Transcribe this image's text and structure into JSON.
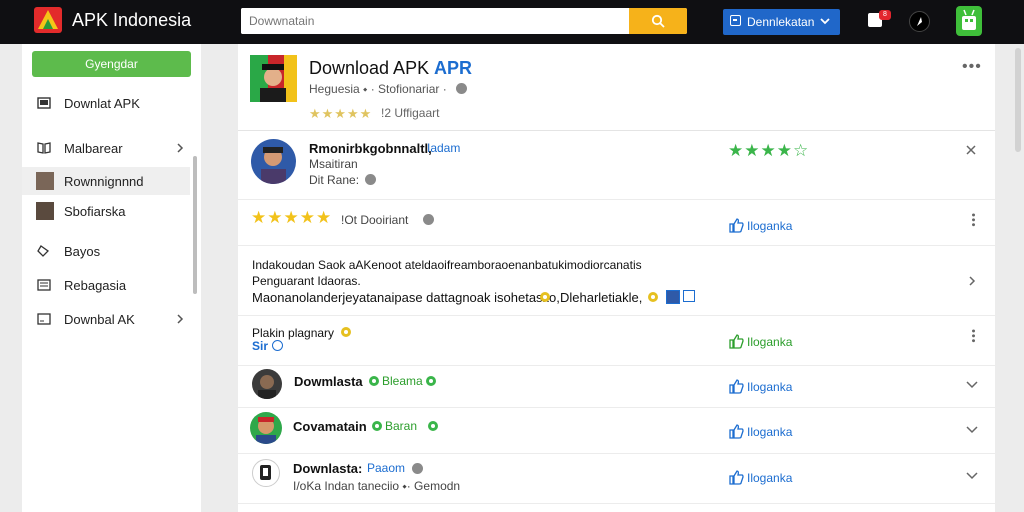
{
  "header": {
    "brand": "APK Indonesia",
    "search_placeholder": "Dowwnatain",
    "download_label": "Dennlekatan",
    "notif_count": "8"
  },
  "sidebar": {
    "primary_button": "Gyengdar",
    "items": [
      {
        "label": "Downlat APK"
      },
      {
        "label": "Malbarear"
      },
      {
        "label": "Rownnignnnd"
      },
      {
        "label": "Sbofiarska"
      },
      {
        "label": "Bayos"
      },
      {
        "label": "Rebagasia"
      },
      {
        "label": "Downbal AK"
      }
    ]
  },
  "app": {
    "title": "Download APK .",
    "title_accent": "APR",
    "subtitle": "Heguesia ⬩ · Stofionariar ·",
    "rating_stars": "★★★★★",
    "rating_text": "!2 Uffigaart"
  },
  "rows": {
    "r1": {
      "name": "Rmonirbkgobnnaltl,",
      "tag": "Iadam",
      "line2": "Msaitiran",
      "line3": "Dit Rane:",
      "stars": "★★★★☆"
    },
    "r2": {
      "stars": "★★★★★",
      "text": "!Ot Dooiriant",
      "action": "Iloganka"
    },
    "r3": {
      "line1": "Indakoudan Saok aAKenoot ateldaoifreamboraoenanbatukimodiorcanatis",
      "line2": "Penguarant Idaoras.",
      "line3": "Maonanolanderjeyatanaipase dattagnoak isohetasko,",
      "line3b": "Dleharletiakle,"
    },
    "r4": {
      "line1": "Plakin plagnary",
      "line2": "Sir",
      "action": "Iloganka"
    },
    "r5": {
      "name": "Dowmlasta",
      "tag": "Bleama",
      "action": "Iloganka"
    },
    "r6": {
      "name": "Covamatain",
      "tag": "Baran",
      "action": "Iloganka"
    },
    "r7": {
      "name": "Downlasta:",
      "tag": "Paaom",
      "line2": "I/oKa  Indan  taneciio  ⬩·  Gemodn",
      "action": "Iloganka"
    }
  },
  "colors": {
    "accent": "#1c6dd0",
    "brand_green": "#5dbb4c",
    "search_button": "#f6b21a",
    "download_button": "#2067c9"
  }
}
